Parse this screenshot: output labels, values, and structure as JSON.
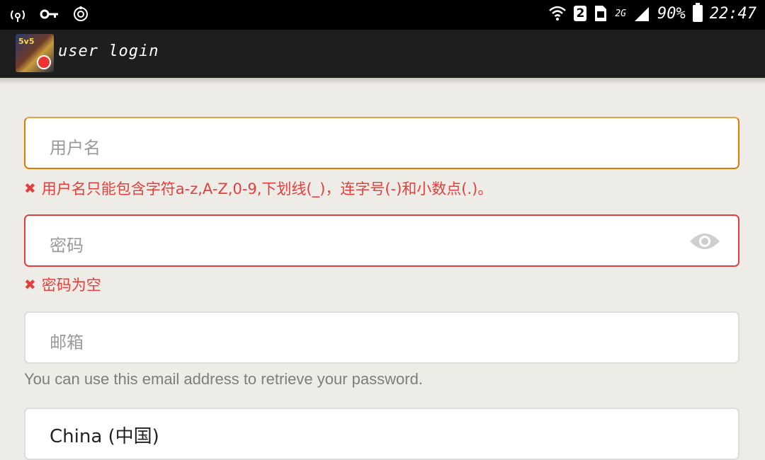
{
  "status_bar": {
    "icons": [
      "wifi-hotspot-icon",
      "vpn-key-icon",
      "sync-icon"
    ],
    "sim": "2",
    "network": "2G",
    "battery": "90%",
    "time": "22:47"
  },
  "app": {
    "title": "user login",
    "icon_tag": "5v5"
  },
  "form": {
    "username": {
      "placeholder": "用户名",
      "error": "用户名只能包含字符a-z,A-Z,0-9,下划线(_)，连字号(-)和小数点(.)。"
    },
    "password": {
      "placeholder": "密码",
      "error": "密码为空"
    },
    "email": {
      "placeholder": "邮箱",
      "hint": "You can use this email address to retrieve your password."
    },
    "country": {
      "value": "China (中国)"
    }
  },
  "colors": {
    "error": "#e43f3f",
    "focus": "#e07b00",
    "background": "#eeece6"
  }
}
